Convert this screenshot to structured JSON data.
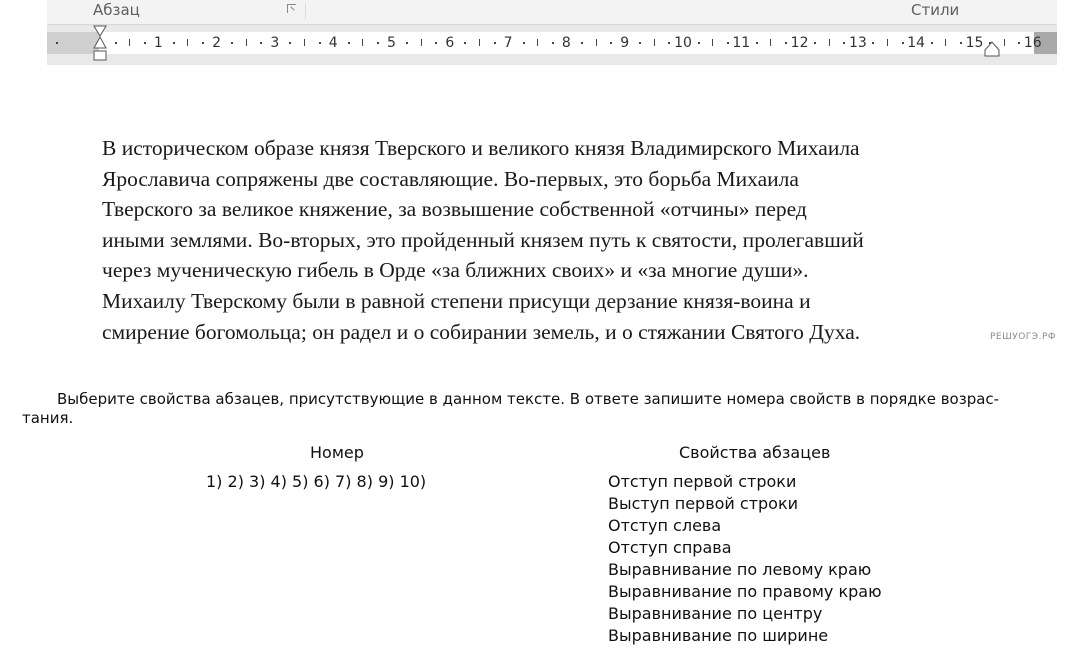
{
  "ribbon": {
    "group_paragraph": "Абзац",
    "group_styles": "Стили"
  },
  "ruler": {
    "marks": [
      "1",
      "2",
      "3",
      "4",
      "5",
      "6",
      "7",
      "8",
      "9",
      "10",
      "11",
      "12",
      "13",
      "14",
      "15",
      "16"
    ],
    "left_indent_icon": "hourglass-indent-marker",
    "right_indent_icon": "right-indent-marker"
  },
  "document": {
    "lines": [
      "В историческом образе князя Тверского и великого князя Владимирского Михаила",
      "Ярославича сопряжены две составляющие. Во-первых, это борьба Михаила",
      "Тверского за великое княжение, за возвышение собственной «отчины» перед",
      "иными землями. Во-вторых, это пройденный князем путь к святости, пролегавший",
      "через мученическую гибель в Орде «за ближних своих» и «за многие души».",
      "Михаилу Тверскому были в равной степени присущи дерзание князя-воина и",
      "смирение богомольца; он радел и о собирании земель, и о стяжании Святого Духа."
    ],
    "watermark": "РЕШУОГЭ.РФ"
  },
  "task": {
    "line1": "Выберите свойства абзацев, присутствующие в данном тексте. В ответе запишите номера свойств в порядке возрас-",
    "line2": "тания."
  },
  "table": {
    "col_number_header": "Номер",
    "col_props_header": "Свойства абзацев",
    "numbers": "1) 2) 3) 4) 5) 6) 7) 8) 9) 10)",
    "properties": [
      "Отступ первой строки",
      "Выступ первой строки",
      "Отступ слева",
      "Отступ справа",
      "Выравнивание по левому краю",
      "Выравнивание по правому краю",
      "Выравнивание по центру",
      "Выравнивание по ширине"
    ]
  }
}
